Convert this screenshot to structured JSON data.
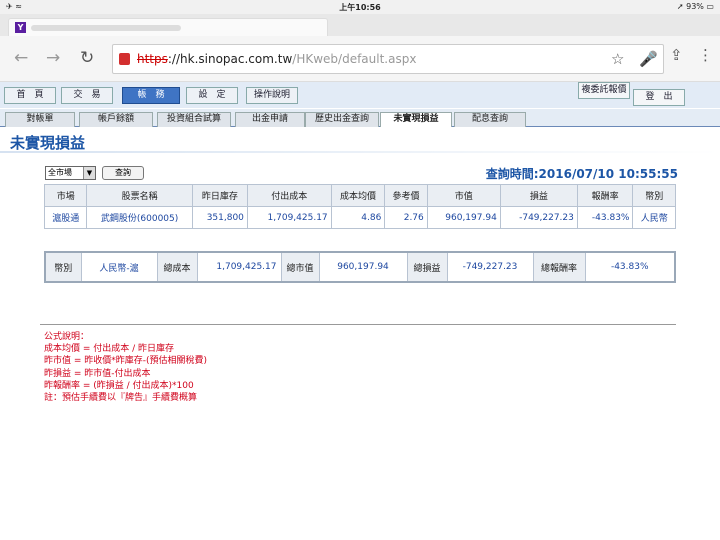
{
  "status": {
    "left": "✈ ≈",
    "time": "上午10:56",
    "right": "➚ 93% ▭"
  },
  "browser": {
    "url_scheme": "https",
    "url_domain": "://hk.sinopac.com.tw",
    "url_path": "/HKweb/default.aspx"
  },
  "menu": {
    "items": [
      "首　頁",
      "交　易",
      "帳　務",
      "設　定",
      "操作說明"
    ],
    "help_btn": "複委託報價",
    "logout_btn": "登　出"
  },
  "subtabs": [
    "對帳單",
    "帳戶餘額",
    "投資組合試算",
    "出金申請",
    "歷史出金查詢",
    "未實現損益",
    "配息查詢"
  ],
  "page": {
    "title": "未實現損益",
    "market_value": "全市場",
    "query_label": "查詢",
    "query_time": "查詢時間:2016/07/10 10:55:55"
  },
  "table": {
    "headers": [
      "市場",
      "股票名稱",
      "昨日庫存",
      "付出成本",
      "成本均價",
      "參考價",
      "市值",
      "損益",
      "報酬率",
      "幣別"
    ],
    "rows": [
      [
        "滬股通",
        "武鋼股份(600005)",
        "351,800",
        "1,709,425.17",
        "4.86",
        "2.76",
        "960,197.94",
        "-749,227.23",
        "-43.83%",
        "人民幣"
      ]
    ]
  },
  "summary": {
    "currency_label": "幣別",
    "currency": "人民幣-滬",
    "cost_label": "總成本",
    "cost": "1,709,425.17",
    "mv_label": "總市值",
    "mv": "960,197.94",
    "pl_label": "總損益",
    "pl": "-749,227.23",
    "rr_label": "總報酬率",
    "rr": "-43.83%"
  },
  "formula": [
    "公式說明：",
    "成本均價 = 付出成本 / 昨日庫存",
    "昨市值 = 昨收價*昨庫存-(預估相關稅費)",
    "昨損益 = 昨市值-付出成本",
    "昨報酬率 = (昨損益 / 付出成本)*100",
    "註：預估手續費以『牌告』手續費概算"
  ]
}
